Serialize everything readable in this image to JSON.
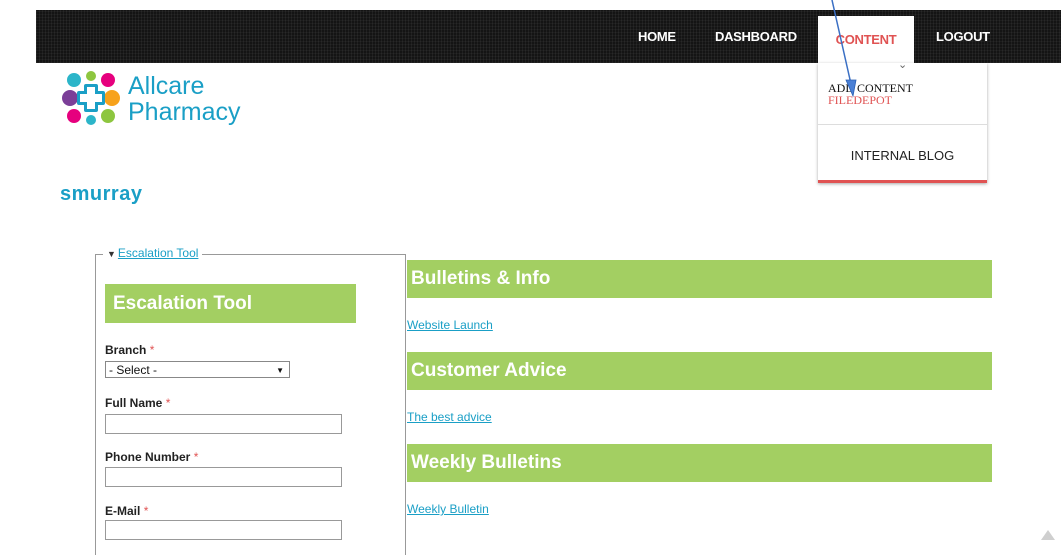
{
  "nav": {
    "home": "HOME",
    "dashboard": "DASHBOARD",
    "content": "CONTENT",
    "logout": "LOGOUT"
  },
  "dropdown": {
    "add_content": "ADD CONTENT",
    "filedepot": "FILEDEPOT",
    "internal_blog": "INTERNAL BLOG"
  },
  "logo": {
    "line1": "Allcare",
    "line2": "Pharmacy",
    "colors": [
      "#2cb5c9",
      "#8dc63f",
      "#e6007e",
      "#7b3f98",
      "#f7a21b",
      "#1a9fc6"
    ]
  },
  "user": {
    "name": "smurray"
  },
  "escalation": {
    "legend": "Escalation Tool",
    "header": "Escalation Tool",
    "branch_label": "Branch",
    "branch_value": "- Select -",
    "full_name_label": "Full Name",
    "phone_label": "Phone Number",
    "email_label": "E-Mail",
    "required_mark": "*"
  },
  "sections": [
    {
      "title": "Bulletins & Info",
      "link": "Website Launch"
    },
    {
      "title": "Customer Advice",
      "link": "The best advice"
    },
    {
      "title": "Weekly Bulletins",
      "link": "Weekly Bulletin"
    }
  ],
  "colors": {
    "accent_red": "#e05353",
    "brand_blue": "#1a9fc6",
    "header_green": "#a3cf62",
    "nav_bg": "#141414"
  }
}
